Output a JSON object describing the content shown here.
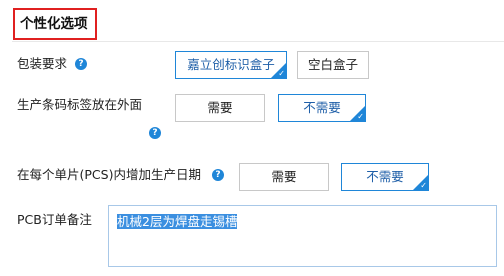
{
  "section": {
    "title": "个性化选项"
  },
  "packaging": {
    "label": "包装要求",
    "help_icon": "help-icon",
    "options": [
      "嘉立创标识盒子",
      "空白盒子"
    ],
    "selected": "嘉立创标识盒子"
  },
  "barcode": {
    "label": "生产条码标签放在外面",
    "help_icon": "help-icon",
    "options": [
      "需要",
      "不需要"
    ],
    "selected": "不需要"
  },
  "date": {
    "label": "在每个单片(PCS)内增加生产日期",
    "help_icon": "help-icon",
    "options": [
      "需要",
      "不需要"
    ],
    "selected": "不需要"
  },
  "remark": {
    "label": "PCB订单备注",
    "value": "机械2层为焊盘走锡槽"
  },
  "colors": {
    "accent": "#1f86d8",
    "title_border": "#e02020"
  }
}
